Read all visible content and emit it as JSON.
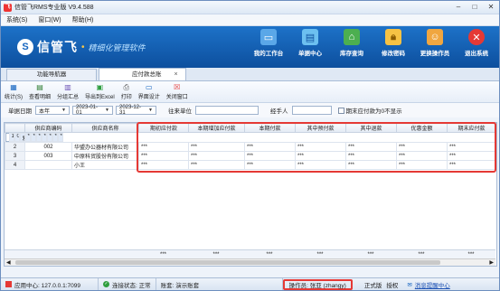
{
  "window": {
    "title": "信管飞RMS专业版 V9.4.588"
  },
  "menu": [
    "系统(S)",
    "窗口(W)",
    "帮助(H)"
  ],
  "banner": {
    "brand": "信管飞",
    "dot": "•",
    "subtitle": "精细化管理软件",
    "buttons": [
      {
        "label": "我的工作台",
        "icon": "desktop-icon"
      },
      {
        "label": "单据中心",
        "icon": "monitor-icon"
      },
      {
        "label": "库存查询",
        "icon": "warehouse-icon"
      },
      {
        "label": "修改密码",
        "icon": "lock-icon"
      },
      {
        "label": "更换操作员",
        "icon": "user-switch-icon"
      },
      {
        "label": "退出系统",
        "icon": "exit-icon"
      }
    ]
  },
  "tabs": [
    {
      "label": "功能导航器"
    },
    {
      "label": "应付款总账",
      "close": "×"
    }
  ],
  "toolbar": [
    "统计(S)",
    "查看明细",
    "分组汇总",
    "导出到Excel",
    "打印",
    "界面设计",
    "关闭窗口"
  ],
  "filter": {
    "date_label": "单据日期",
    "period": "本年",
    "date_from": "2023-01-01",
    "date_to": "2023-12-31",
    "unit_label": "往来单位",
    "handler_label": "经手人",
    "zero_check_label": "期末应付款为0不显示"
  },
  "grid": {
    "columns": [
      "供应商编码",
      "供应商名称",
      "期初应付款",
      "本期增加应付款",
      "本期付款",
      "其中预付款",
      "其中退款",
      "优惠金额",
      "期末应付款"
    ],
    "rows": [
      {
        "n": "1",
        "code": "001",
        "name": "爱普生中国有限公司",
        "vals": [
          "***",
          "***",
          "***",
          "***",
          "***",
          "***",
          "***"
        ]
      },
      {
        "n": "2",
        "code": "002",
        "name": "华盟办公器材有限公司",
        "vals": [
          "***",
          "***",
          "***",
          "***",
          "***",
          "***",
          "***"
        ]
      },
      {
        "n": "3",
        "code": "003",
        "name": "中原科贸股份有限公司",
        "vals": [
          "***",
          "***",
          "***",
          "***",
          "***",
          "***",
          "***"
        ]
      },
      {
        "n": "4",
        "code": "",
        "name": "小王",
        "vals": [
          "***",
          "***",
          "***",
          "***",
          "***",
          "***",
          "***"
        ]
      }
    ],
    "totals": [
      "***",
      "***",
      "***",
      "***",
      "***",
      "***",
      "***"
    ]
  },
  "status": {
    "app_center": "应用中心: 127.0.0.1:7099",
    "conn": "连接状态: 正常",
    "account": "账套: 演示账套",
    "operator": "操作员: 张亚 (zhangy)",
    "edition": "正式版",
    "register": "授权",
    "message": "消息提醒中心"
  },
  "colors": {
    "accent": "#1565c0",
    "highlight": "#e53935"
  }
}
